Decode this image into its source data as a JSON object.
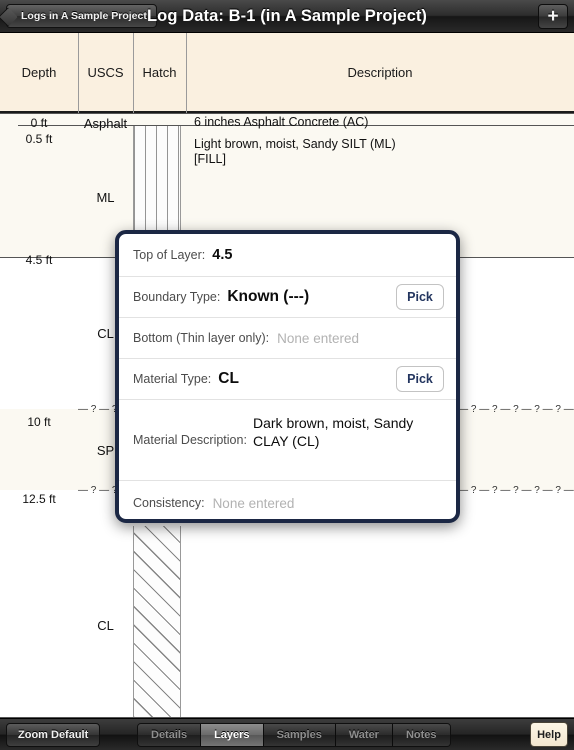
{
  "topbar": {
    "back_label": "Logs in A Sample Project",
    "title": "Log Data: B-1 (in A Sample Project)",
    "add_label": "+"
  },
  "columns": {
    "depth": "Depth",
    "uscs": "USCS",
    "hatch": "Hatch",
    "description": "Description"
  },
  "log": {
    "depth_labels": [
      "0 ft",
      "0.5 ft",
      "4.5 ft",
      "10 ft",
      "12.5 ft"
    ],
    "uscs_labels": [
      "Asphalt",
      "ML",
      "CL",
      "SP",
      "CL"
    ],
    "descriptions": [
      "6 inches Asphalt Concrete (AC)",
      "Light brown, moist, Sandy SILT (ML)",
      "[FILL]"
    ],
    "boundary_dash": "— ? — ? — ? — ? — ? — ? — ? — ? — ? — ? — ? — ? — ? — ? — ? — ? — ? — ? — ? — ? — ? — ? — ? — ? — ? — ? — ? — ? — ? — ? — ? — ? — ? — ? — ?"
  },
  "modal": {
    "rows": {
      "top_of_layer": {
        "label": "Top of Layer:",
        "value": "4.5"
      },
      "boundary_type": {
        "label": "Boundary Type:",
        "value": "Known (---)",
        "pick": "Pick"
      },
      "bottom_thin": {
        "label": "Bottom (Thin layer only):",
        "placeholder": "None entered"
      },
      "material_type": {
        "label": "Material Type:",
        "value": "CL",
        "pick": "Pick"
      },
      "material_description": {
        "label": "Material Description:",
        "value": "Dark brown, moist, Sandy CLAY (CL)"
      },
      "consistency": {
        "label": "Consistency:",
        "placeholder": "None entered"
      }
    }
  },
  "bottombar": {
    "zoom_default": "Zoom Default",
    "tabs": [
      {
        "label": "Details",
        "active": false
      },
      {
        "label": "Layers",
        "active": true
      },
      {
        "label": "Samples",
        "active": false
      },
      {
        "label": "Water",
        "active": false
      },
      {
        "label": "Notes",
        "active": false
      }
    ],
    "help": "Help"
  },
  "colors": {
    "header_bg": "#faf0e0",
    "modal_border": "#1b2744",
    "pick_text": "#23355f"
  }
}
